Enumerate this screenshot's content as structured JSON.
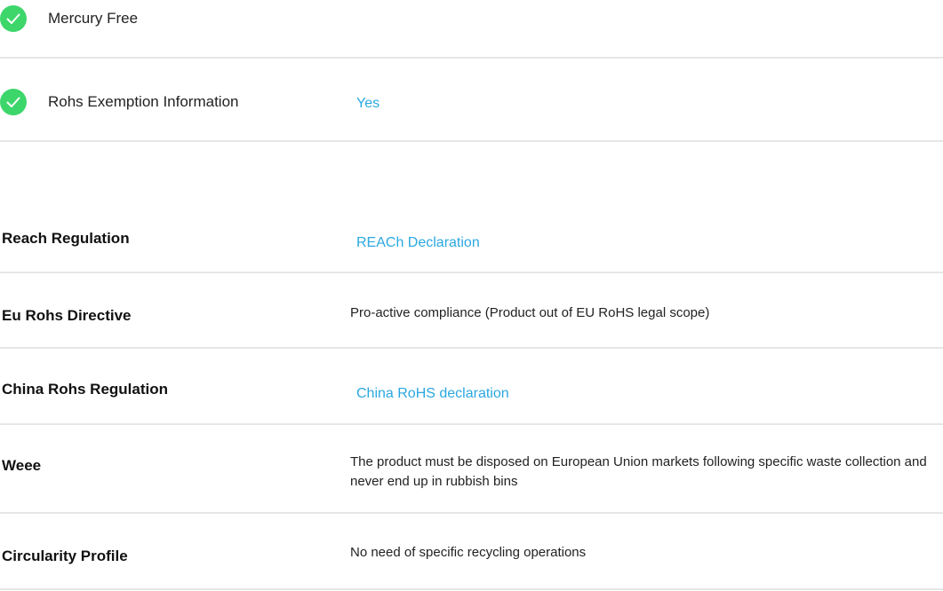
{
  "features": [
    {
      "label": "Mercury Free",
      "value": ""
    },
    {
      "label": "Rohs Exemption Information",
      "value": "Yes"
    }
  ],
  "regulations": [
    {
      "label": "Reach Regulation",
      "value": "REACh Declaration",
      "is_link": true
    },
    {
      "label": "Eu Rohs Directive",
      "value": "Pro-active compliance (Product out of EU RoHS legal scope)",
      "is_link": false
    },
    {
      "label": "China Rohs Regulation",
      "value": "China RoHS declaration",
      "is_link": true
    },
    {
      "label": "Weee",
      "value": "The product must be disposed on European Union markets following specific waste collection and never end up in rubbish bins",
      "is_link": false
    },
    {
      "label": "Circularity Profile",
      "value": "No need of specific recycling operations",
      "is_link": false
    }
  ],
  "colors": {
    "check": "#3dd66b",
    "link": "#2ba8e0",
    "divider": "#e6e6e6"
  },
  "icons": {
    "check": "check-circle-icon"
  }
}
